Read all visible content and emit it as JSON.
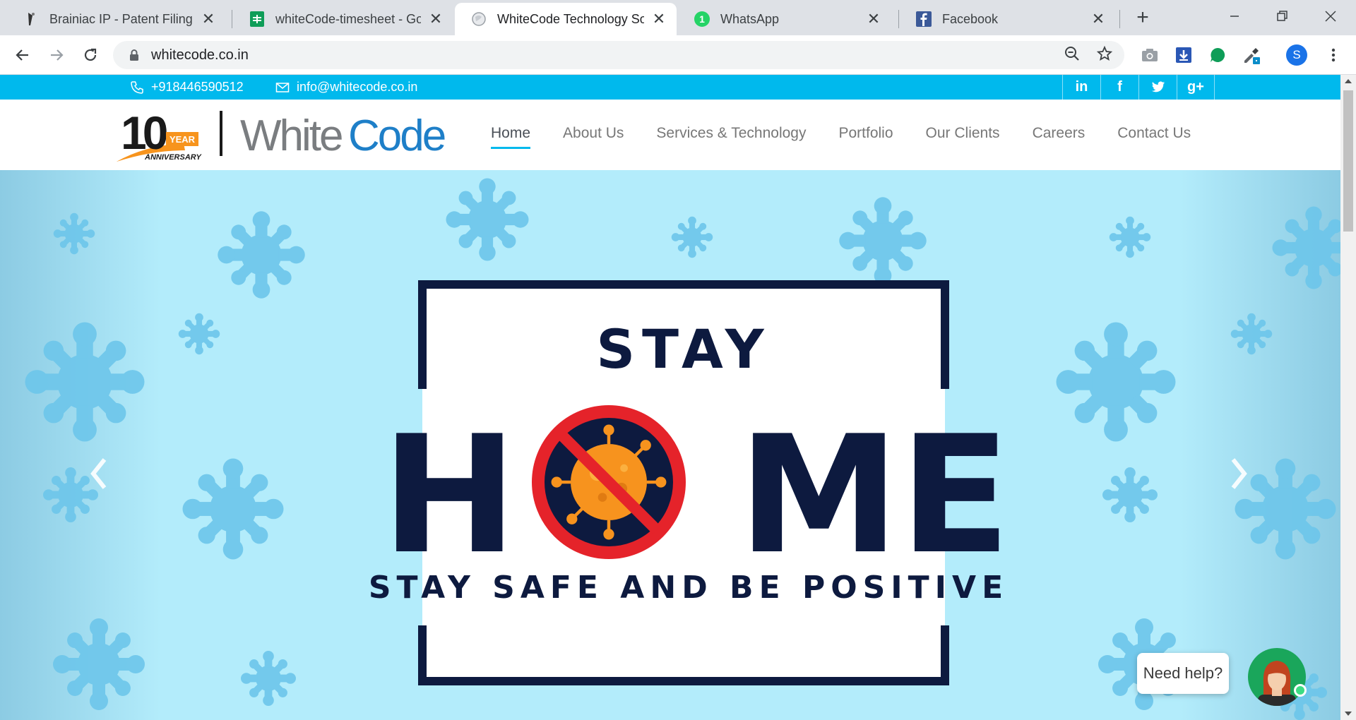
{
  "browser": {
    "tabs": [
      {
        "title": "Brainiac IP - Patent Filing, Trademark",
        "icon": "brainiac-favicon-icon",
        "active": false
      },
      {
        "title": "whiteCode-timesheet - Google Sheets",
        "icon": "sheets-favicon-icon",
        "active": false
      },
      {
        "title": "WhiteCode Technology Solutions",
        "icon": "globe-favicon-icon",
        "active": true
      },
      {
        "title": "WhatsApp",
        "icon": "whatsapp-favicon-icon",
        "active": false
      },
      {
        "title": "Facebook",
        "icon": "facebook-favicon-icon",
        "active": false
      }
    ],
    "url": "whitecode.co.in",
    "profile_initial": "S"
  },
  "topbar": {
    "phone": "+918446590512",
    "email": "info@whitecode.co.in",
    "social": [
      {
        "name": "linkedin-icon",
        "label": "in"
      },
      {
        "name": "facebook-icon",
        "label": "f"
      },
      {
        "name": "twitter-icon",
        "label": ""
      },
      {
        "name": "google-plus-icon",
        "label": "g+"
      }
    ]
  },
  "logo": {
    "anniversary_number": "10",
    "anniversary_year": "YEAR",
    "anniversary_text": "ANNIVERSARY",
    "brand_white": "White",
    "brand_code": "Code"
  },
  "nav": {
    "items": [
      "Home",
      "About Us",
      "Services & Technology",
      "Portfolio",
      "Our Clients",
      "Careers",
      "Contact Us"
    ],
    "active": "Home"
  },
  "hero": {
    "line1": "STAY",
    "line2_left": "H",
    "line2_right": "ME",
    "line3": "STAY SAFE AND BE POSITIVE"
  },
  "help_widget": {
    "label": "Need help?"
  },
  "colors": {
    "accent": "#00b9ed",
    "hero_bg": "#b3ecfb",
    "virus_light": "#6cc6ea",
    "navy": "#0d1a3f",
    "forbidden_red": "#e5232a",
    "virus_orange": "#f7931e",
    "logo_orange": "#f7941d"
  }
}
